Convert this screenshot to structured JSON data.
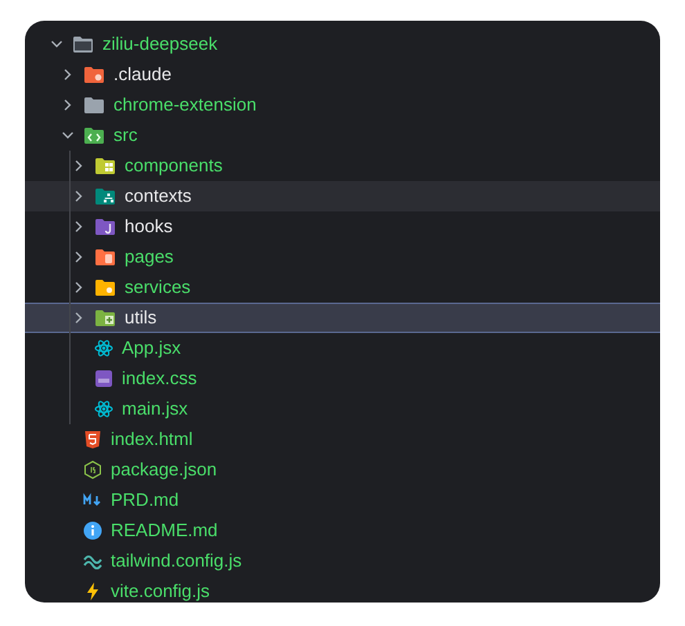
{
  "tree": [
    {
      "name": "ziliu-deepseek",
      "kind": "rootfolder",
      "expanded": true,
      "untracked": true,
      "selected": false,
      "hovered": false,
      "children": [
        {
          "name": ".claude",
          "kind": "claudefolder",
          "expanded": false,
          "untracked": false,
          "selected": false,
          "hovered": false
        },
        {
          "name": "chrome-extension",
          "kind": "greyfolder",
          "expanded": false,
          "untracked": true,
          "selected": false,
          "hovered": false
        },
        {
          "name": "src",
          "kind": "codefolder",
          "expanded": true,
          "untracked": true,
          "selected": false,
          "hovered": false,
          "children": [
            {
              "name": "components",
              "kind": "gridfolder",
              "expanded": false,
              "untracked": true,
              "selected": false,
              "hovered": false
            },
            {
              "name": "contexts",
              "kind": "treefolder",
              "expanded": false,
              "untracked": false,
              "selected": false,
              "hovered": true
            },
            {
              "name": "hooks",
              "kind": "hookfolder",
              "expanded": false,
              "untracked": false,
              "selected": false,
              "hovered": false
            },
            {
              "name": "pages",
              "kind": "pagefolder",
              "expanded": false,
              "untracked": true,
              "selected": false,
              "hovered": false
            },
            {
              "name": "services",
              "kind": "gearfolder",
              "expanded": false,
              "untracked": true,
              "selected": false,
              "hovered": false
            },
            {
              "name": "utils",
              "kind": "plusfolder",
              "expanded": false,
              "untracked": false,
              "selected": true,
              "hovered": false
            },
            {
              "name": "App.jsx",
              "kind": "react",
              "untracked": true,
              "selected": false,
              "hovered": false
            },
            {
              "name": "index.css",
              "kind": "css",
              "untracked": true,
              "selected": false,
              "hovered": false
            },
            {
              "name": "main.jsx",
              "kind": "react",
              "untracked": true,
              "selected": false,
              "hovered": false
            }
          ]
        },
        {
          "name": "index.html",
          "kind": "html",
          "untracked": true,
          "selected": false,
          "hovered": false
        },
        {
          "name": "package.json",
          "kind": "nodejs",
          "untracked": true,
          "selected": false,
          "hovered": false
        },
        {
          "name": "PRD.md",
          "kind": "markdown",
          "untracked": true,
          "selected": false,
          "hovered": false
        },
        {
          "name": "README.md",
          "kind": "info",
          "untracked": true,
          "selected": false,
          "hovered": false
        },
        {
          "name": "tailwind.config.js",
          "kind": "tailwind",
          "untracked": true,
          "selected": false,
          "hovered": false
        },
        {
          "name": "vite.config.js",
          "kind": "vite",
          "untracked": true,
          "selected": false,
          "hovered": false
        }
      ]
    }
  ]
}
